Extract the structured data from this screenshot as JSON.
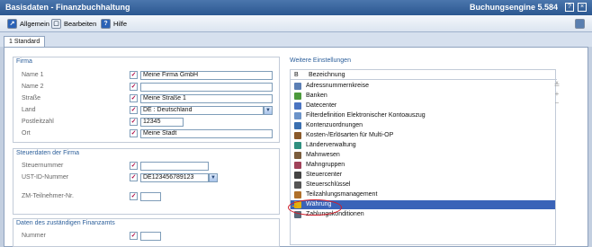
{
  "window": {
    "title": "Basisdaten - Finanzbuchhaltung",
    "right_title": "Buchungsengine 5.584",
    "help_btn": "?",
    "close_btn": "×"
  },
  "menu": [
    {
      "label": "Allgemein",
      "icon": "↗"
    },
    {
      "label": "Bearbeiten",
      "icon": "▢"
    },
    {
      "label": "Hilfe",
      "icon": "?"
    }
  ],
  "tab": {
    "label": "1 Standard"
  },
  "firma": {
    "title": "Firma",
    "fields": [
      {
        "label": "Name 1",
        "value": "Meine Firma GmbH"
      },
      {
        "label": "Name 2",
        "value": ""
      },
      {
        "label": "Straße",
        "value": "Meine Straße 1"
      },
      {
        "label": "Land",
        "value": "DE    : Deutschland"
      },
      {
        "label": "Postleitzahl",
        "value": "12345"
      },
      {
        "label": "Ort",
        "value": "Meine Stadt"
      }
    ]
  },
  "steuer": {
    "title": "Steuerdaten der Firma",
    "fields": [
      {
        "label": "Steuernummer",
        "value": ""
      },
      {
        "label": "UST-ID-Nummer",
        "value": "DE123456789123"
      },
      {
        "label": "ZM-Teilnehmer-Nr.",
        "value": ""
      }
    ]
  },
  "finanzamt": {
    "title": "Daten des zuständigen Finanzamts",
    "fields": [
      {
        "label": "Nummer",
        "value": ""
      }
    ]
  },
  "weitere": {
    "title": "Weitere Einstellungen",
    "col_b": "B",
    "col_name": "Bezeichnung",
    "items": [
      {
        "label": "Adressnummernkreise",
        "color": "#5b7fb5"
      },
      {
        "label": "Banken",
        "color": "#4c9a3c"
      },
      {
        "label": "Datecenter",
        "color": "#4a74c2"
      },
      {
        "label": "Filterdefinition Elektronischer Kontoauszug",
        "color": "#6b93c9"
      },
      {
        "label": "Kontenzuordnungen",
        "color": "#3a6fb0"
      },
      {
        "label": "Kosten-/Erlösarten für Multi-OP",
        "color": "#8a5a2a"
      },
      {
        "label": "Länderverwaltung",
        "color": "#2f8f7f"
      },
      {
        "label": "Mahnwesen",
        "color": "#7a5c3c"
      },
      {
        "label": "Mahngruppen",
        "color": "#a0425a"
      },
      {
        "label": "Steuercenter",
        "color": "#444444"
      },
      {
        "label": "Steuerschlüssel",
        "color": "#555555"
      },
      {
        "label": "Teilzahlungsmanagement",
        "color": "#b0702a"
      },
      {
        "label": "Währung",
        "color": "#e2b10f"
      },
      {
        "label": "Zahlungskonditionen",
        "color": "#5a6a7a"
      }
    ],
    "selected": 12,
    "side": [
      "≚",
      "+",
      "−"
    ]
  }
}
